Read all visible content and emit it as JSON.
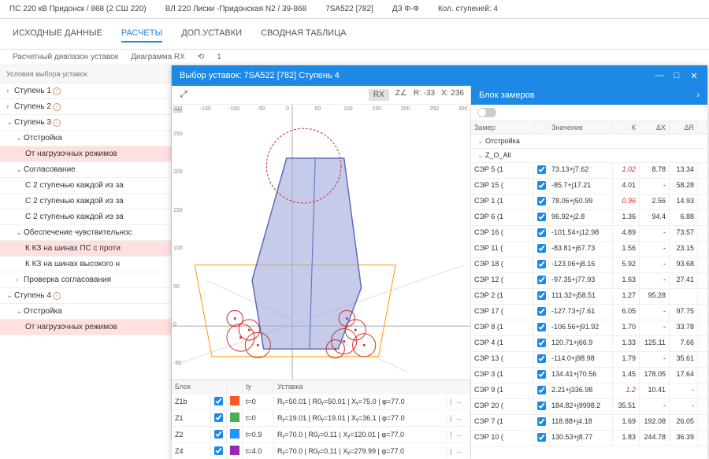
{
  "breadcrumb": [
    "ПС 220 кВ Придонск / 868 (2 СШ 220)",
    "ВЛ 220 Лиски -Придонская N2 / 39-868",
    "7SA522 [782]",
    "ДЗ Ф-Ф",
    "Кол. ступеней: 4"
  ],
  "tabs": [
    "ИСХОДНЫЕ ДАННЫЕ",
    "РАСЧЕТЫ",
    "ДОП.УСТАВКИ",
    "СВОДНАЯ ТАБЛИЦА"
  ],
  "tabs_active": 1,
  "subbar": {
    "calc_range": "Расчетный диапазон уставок",
    "diag": "Диаграмма RX",
    "zoom": "1"
  },
  "sidebar": {
    "header": "Условия выбора уставок",
    "items": [
      {
        "lvl": "l1",
        "chev": "›",
        "label": "Ступень 1",
        "warn": true
      },
      {
        "lvl": "l1",
        "chev": "›",
        "label": "Ступень 2",
        "warn": true
      },
      {
        "lvl": "l1",
        "chev": "⌄",
        "label": "Ступень 3",
        "warn": true
      },
      {
        "lvl": "l2",
        "chev": "⌄",
        "label": "Отстройка"
      },
      {
        "lvl": "l3",
        "label": "От нагрузочных режимов",
        "hl": true
      },
      {
        "lvl": "l2",
        "chev": "⌄",
        "label": "Согласование"
      },
      {
        "lvl": "l3",
        "label": "С 2 ступенью каждой из за"
      },
      {
        "lvl": "l3",
        "label": "С 2 ступенью каждой из за"
      },
      {
        "lvl": "l3",
        "label": "С 2 ступенью каждой из за"
      },
      {
        "lvl": "l2",
        "chev": "⌄",
        "label": "Обеспечение чувствительнос"
      },
      {
        "lvl": "l3",
        "label": "К КЗ на шинах ПС с проти",
        "hl": true
      },
      {
        "lvl": "l3",
        "label": "К КЗ на шинах высокого н"
      },
      {
        "lvl": "l2",
        "chev": "›",
        "label": "Проверка согласования"
      },
      {
        "lvl": "l1",
        "chev": "⌄",
        "label": "Ступень 4",
        "warn": true
      },
      {
        "lvl": "l2",
        "chev": "⌄",
        "label": "Отстройка"
      },
      {
        "lvl": "l3",
        "label": "От нагрузочных режимов",
        "hl": true
      }
    ]
  },
  "dialog": {
    "title": "Выбор уставок: 7SA522 [782] Ступень 4",
    "toolbar": {
      "mode_rx": "RX",
      "mode_z": "Z∠",
      "r_label": "R: -33",
      "x_label": "X: 236"
    }
  },
  "chart_data": {
    "type": "scatter",
    "title": "",
    "xlabel": "",
    "ylabel": "",
    "xticks": [
      -200,
      -150,
      -100,
      -50,
      0,
      50,
      100,
      150,
      200,
      250,
      300
    ],
    "yticks": [
      -50,
      0,
      50,
      100,
      150,
      200,
      250,
      280
    ],
    "xlim": [
      -210,
      310
    ],
    "ylim": [
      -70,
      290
    ],
    "polygon": [
      [
        -50,
        -30
      ],
      [
        80,
        -30
      ],
      [
        120,
        50
      ],
      [
        90,
        220
      ],
      [
        -10,
        220
      ],
      [
        -70,
        60
      ]
    ],
    "big_circle": {
      "cx": 20,
      "cy": 210,
      "r": 65
    },
    "small_circles": [
      {
        "cx": -90,
        "cy": -15,
        "r": 24
      },
      {
        "cx": -75,
        "cy": -5,
        "r": 18
      },
      {
        "cx": -60,
        "cy": -25,
        "r": 22
      },
      {
        "cx": -100,
        "cy": 10,
        "r": 14
      },
      {
        "cx": 90,
        "cy": -20,
        "r": 22
      },
      {
        "cx": 110,
        "cy": -5,
        "r": 18
      },
      {
        "cx": 125,
        "cy": -25,
        "r": 20
      },
      {
        "cx": 95,
        "cy": 10,
        "r": 14
      },
      {
        "cx": 75,
        "cy": -30,
        "r": 16
      }
    ]
  },
  "zones": {
    "head": {
      "blok": "Блок",
      "ty": "ty",
      "ust": "Уставка"
    },
    "rows": [
      {
        "name": "Z1b",
        "color": "#ff5722",
        "ty": "t=0",
        "ust": "Rᵧ=50.01 | R0ᵧ=50.01 | Xᵧ=75.0 | φ=77.0"
      },
      {
        "name": "Z1",
        "color": "#4caf50",
        "ty": "t=0",
        "ust": "Rᵧ=19.01 | R0ᵧ=19.01 | Xᵧ=36.1 | φ=77.0"
      },
      {
        "name": "Z2",
        "color": "#2196f3",
        "ty": "t=0.9",
        "ust": "Rᵧ=70.0 | R0ᵧ=0.11 | Xᵧ=120.01 | φ=77.0"
      },
      {
        "name": "Z4",
        "color": "#9c27b0",
        "ty": "t=4.0",
        "ust": "Rᵧ=70.0 | R0ᵧ=0.11 | Xᵧ=279.99 | φ=77.0"
      }
    ]
  },
  "meas": {
    "title": "Блок замеров",
    "head": {
      "zamer": "Замер",
      "zn": "Значение",
      "k": "К",
      "dx": "ΔX",
      "dr": "ΔR"
    },
    "group1": "Отстройка",
    "group2": "Z_O_All",
    "group1_chev": "⌄",
    "group2_chev": "⌄",
    "rows": [
      {
        "n": "СЭР 5 (1",
        "zn": "73.13+j7.62",
        "k": "1.02",
        "kred": true,
        "dx": "8.78",
        "dr": "13.34"
      },
      {
        "n": "СЭР 15 (",
        "zn": "-85.7+j17.21",
        "k": "4.01",
        "dx": "-",
        "dr": "58.28"
      },
      {
        "n": "СЭР 1 (1",
        "zn": "78.06+j50.99",
        "k": "0.96",
        "kred": true,
        "dx": "2.56",
        "dr": "14.93"
      },
      {
        "n": "СЭР 6 (1",
        "zn": "96.92+j2.8",
        "k": "1.36",
        "dx": "94.4",
        "dr": "6.88"
      },
      {
        "n": "СЭР 16 (",
        "zn": "-101.54+j12.98",
        "k": "4.89",
        "dx": "-",
        "dr": "73.57"
      },
      {
        "n": "СЭР 11 (",
        "zn": "-83.81+j67.73",
        "k": "1.56",
        "dx": "-",
        "dr": "23.15"
      },
      {
        "n": "СЭР 18 (",
        "zn": "-123.06+j8.16",
        "k": "5.92",
        "dx": "-",
        "dr": "93.68"
      },
      {
        "n": "СЭР 12 (",
        "zn": "-97.35+j77.93",
        "k": "1.63",
        "dx": "-",
        "dr": "27.41"
      },
      {
        "n": "СЭР 2 (1",
        "zn": "111.32+j58.51",
        "k": "1.27",
        "dx": "95.28",
        "dr": ""
      },
      {
        "n": "СЭР 17 (",
        "zn": "-127.73+j7.61",
        "k": "6.05",
        "dx": "-",
        "dr": "97.75"
      },
      {
        "n": "СЭР 8 (1",
        "zn": "-106.56+j91.92",
        "k": "1.70",
        "dx": "-",
        "dr": "33.78"
      },
      {
        "n": "СЭР 4 (1",
        "zn": "120.71+j66.9",
        "k": "1.33",
        "dx": "125.11",
        "dr": "7.66"
      },
      {
        "n": "СЭР 13 (",
        "zn": "-114.0+j98.98",
        "k": "1.79",
        "dx": "-",
        "dr": "35.61"
      },
      {
        "n": "СЭР 3 (1",
        "zn": "134.41+j70.56",
        "k": "1.45",
        "dx": "178.05",
        "dr": "17.64"
      },
      {
        "n": "СЭР 9 (1",
        "zn": "2.21+j336.98",
        "k": "1.2",
        "kred": true,
        "dx": "10.41",
        "dr": "-"
      },
      {
        "n": "СЭР 20 (",
        "zn": "184.82+j9998.2",
        "k": "35.51",
        "dx": "-",
        "dr": "-"
      },
      {
        "n": "СЭР 7 (1",
        "zn": "118.88+j4.18",
        "k": "1.69",
        "dx": "192.08",
        "dr": "26.05"
      },
      {
        "n": "СЭР 10 (",
        "zn": "130.53+j8.77",
        "k": "1.83",
        "dx": "244.78",
        "dr": "36.39"
      }
    ]
  }
}
